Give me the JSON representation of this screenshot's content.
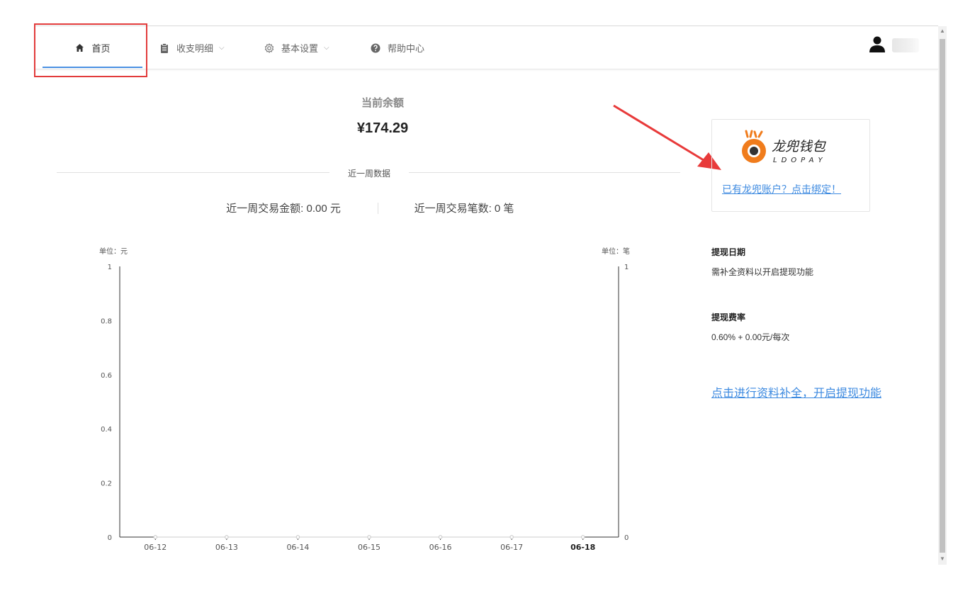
{
  "nav": {
    "home_label": "首页",
    "ledger_label": "收支明细",
    "settings_label": "基本设置",
    "help_label": "帮助中心",
    "caret": "⌵"
  },
  "balance": {
    "label": "当前余额",
    "value": "¥174.29"
  },
  "week": {
    "divider_label": "近一周数据",
    "amount_text": "近一周交易金额:  0.00 元",
    "count_text": "近一周交易笔数:  0 笔"
  },
  "ldopay": {
    "brand_cn": "龙兜钱包",
    "brand_en": "LDOPAY",
    "bind_link": "已有龙兜账户？点击绑定！"
  },
  "withdraw": {
    "date_title": "提现日期",
    "date_text": "需补全资料以开启提现功能",
    "fee_title": "提现费率",
    "fee_text": "0.60% + 0.00元/每次",
    "complete_link": "点击进行资料补全，开启提现功能"
  },
  "colors": {
    "accent": "#4a90e2",
    "link": "#3d8ae0",
    "highlight": "#e23b3b",
    "brand_orange": "#f07c1c"
  },
  "chart_data": {
    "type": "line",
    "categories": [
      "06-12",
      "06-13",
      "06-14",
      "06-15",
      "06-16",
      "06-17",
      "06-18"
    ],
    "series": [
      {
        "values": [
          0,
          0,
          0,
          0,
          0,
          0,
          0
        ],
        "axis": "left"
      },
      {
        "values": [
          0,
          0,
          0,
          0,
          0,
          0,
          0
        ],
        "axis": "right"
      }
    ],
    "left_axis": {
      "unit_label": "单位：元",
      "ticks": [
        "1",
        "0.8",
        "0.6",
        "0.4",
        "0.2",
        "0"
      ],
      "ylim": [
        0,
        1
      ]
    },
    "right_axis": {
      "unit_label": "单位：笔",
      "ticks": [
        "1",
        "0"
      ],
      "ylim": [
        0,
        1
      ]
    },
    "highlighted_category": "06-18",
    "grid": false
  }
}
